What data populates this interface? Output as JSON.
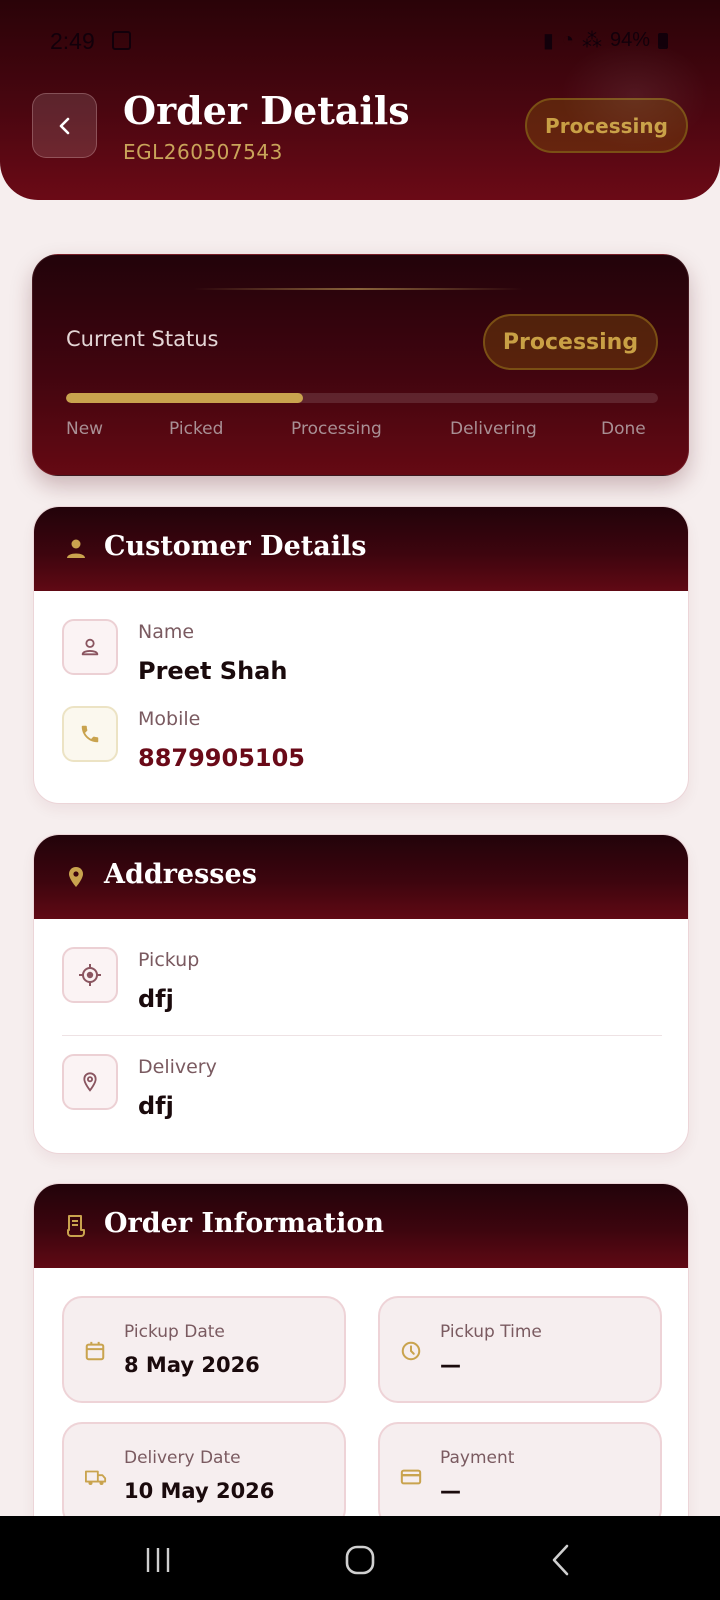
{
  "statusbar": {
    "time": "2:49",
    "battery": "94%"
  },
  "header": {
    "title": "Order Details",
    "order_id": "EGL260507543",
    "status_pill": "Processing"
  },
  "status_card": {
    "label": "Current Status",
    "pill": "Processing",
    "progress": 0.4,
    "steps": [
      "New",
      "Picked",
      "Processing",
      "Delivering",
      "Done"
    ]
  },
  "customer": {
    "title": "Customer Details",
    "name_label": "Name",
    "name": "Preet Shah",
    "mobile_label": "Mobile",
    "mobile": "8879905105"
  },
  "addresses": {
    "title": "Addresses",
    "pickup_label": "Pickup",
    "pickup": "dfj",
    "delivery_label": "Delivery",
    "delivery": "dfj"
  },
  "order_info": {
    "title": "Order Information",
    "pickup_date_label": "Pickup Date",
    "pickup_date": "8 May 2026",
    "pickup_time_label": "Pickup Time",
    "pickup_time": "—",
    "delivery_date_label": "Delivery Date",
    "delivery_date": "10 May 2026",
    "payment_label": "Payment",
    "payment": "—"
  },
  "colors": {
    "maroon": "#6b0a16",
    "gold": "#c9a34e",
    "background": "#f6eeee"
  }
}
